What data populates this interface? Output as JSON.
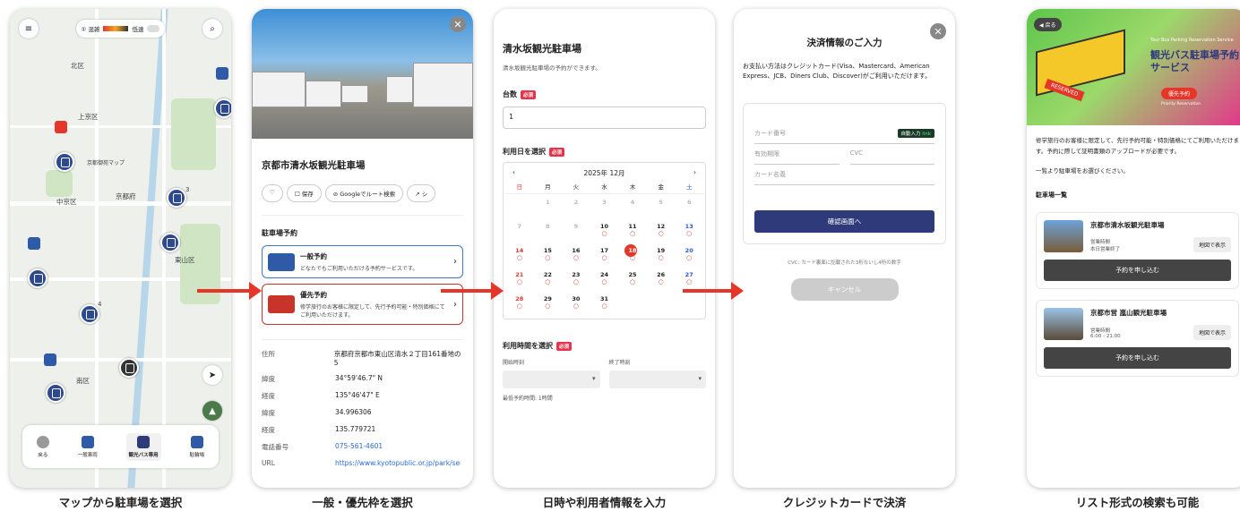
{
  "captions": [
    "マップから駐車場を選択",
    "一般・優先枠を選択",
    "日時や利用者情報を入力",
    "クレジットカードで決済",
    "リスト形式の検索も可能"
  ],
  "map": {
    "congestion_left": "① 混雑",
    "congestion_right": "低速",
    "labels": [
      "北区",
      "上京区",
      "京都府",
      "中京区",
      "京都御苑マップ",
      "東山区",
      "南区",
      "空港",
      "混雑",
      "当条",
      "京都市"
    ],
    "pin_counts": [
      "3",
      "4"
    ],
    "nav": [
      {
        "label": "戻る"
      },
      {
        "label": "一般車両"
      },
      {
        "label": "観光バス専用"
      },
      {
        "label": "駐輪場"
      }
    ]
  },
  "detail": {
    "title": "京都市清水坂観光駐車場",
    "actions": [
      "保存",
      "Googleでルート検索",
      "シ"
    ],
    "section": "駐車場予約",
    "general": {
      "title": "一般予約",
      "desc": "どなたでもご利用いただける予約サービスです。"
    },
    "priority": {
      "title": "優先予約",
      "desc": "修学旅行のお客様に限定して、先行予約可能・特別価格にてご利用いただけます。"
    },
    "info": [
      {
        "k": "住所",
        "v": "京都府京都市東山区清水２丁目161番地の5"
      },
      {
        "k": "緯度",
        "v": "34°59'46.7\" N"
      },
      {
        "k": "経度",
        "v": "135°46'47\" E"
      },
      {
        "k": "緯度",
        "v": "34.996306"
      },
      {
        "k": "経度",
        "v": "135.779721"
      },
      {
        "k": "電話番号",
        "v": "075-561-4601"
      },
      {
        "k": "URL",
        "v": "https://www.kyotopublic.or.jp/park/sei"
      }
    ]
  },
  "booking": {
    "title": "清水坂観光駐車場",
    "subtitle": "清水坂観光駐車場の予約ができます。",
    "count_label": "台数",
    "required": "必須",
    "count_value": "1",
    "date_label": "利用日を選択",
    "month": "2025年 12月",
    "weekdays": [
      "日",
      "月",
      "火",
      "水",
      "木",
      "金",
      "土"
    ],
    "rows": [
      [
        "",
        "1",
        "2",
        "3",
        "4",
        "5",
        "6"
      ],
      [
        "7",
        "8",
        "9",
        "10",
        "11",
        "12",
        "13"
      ],
      [
        "14",
        "15",
        "16",
        "17",
        "18",
        "19",
        "20"
      ],
      [
        "21",
        "22",
        "23",
        "24",
        "25",
        "26",
        "27"
      ],
      [
        "28",
        "29",
        "30",
        "31",
        "",
        "",
        ""
      ]
    ],
    "time_label": "利用時間を選択",
    "start_label": "開始時刻",
    "end_label": "終了時刻",
    "min_note": "最低予約時間: 1時間"
  },
  "payment": {
    "title": "決済情報のご入力",
    "desc": "お支払い方法はクレジットカード(Visa、Mastercard、American Express、JCB、Diners Club、Discover)がご利用いただけます。",
    "card_number": "カード番号",
    "autofill": "自動入力",
    "autofill_brand": "link",
    "expiry": "有効期限",
    "cvc": "CVC",
    "card_name": "カード名義",
    "confirm": "確認画面へ",
    "cvc_note": "CVC: カード裏面に記載された3桁ないし4桁の数字",
    "cancel": "キャンセル"
  },
  "list": {
    "back": "戻る",
    "hero_en": "Tour Bus Parking Reservation Service",
    "hero_title": "観光バス駐車場予約サービス",
    "hero_badge": "優先予約",
    "hero_badge_en": "Priority Reservation",
    "reserved": "RESERVED",
    "intro": "修学旅行のお客様に限定して、先行予約可能・特別価格にてご利用いただけます。予約に際して証明書類のアップロードが必要です。",
    "choose": "一覧より駐車場をお選びください。",
    "list_title": "駐車場一覧",
    "lots": [
      {
        "name": "京都市清水坂観光駐車場",
        "hours_label": "営業時間",
        "hours": "本日営業終了",
        "map": "地図で表示",
        "reserve": "予約を申し込む"
      },
      {
        "name": "京都市営 嵐山観光駐車場",
        "hours_label": "営業時間",
        "hours": "6:00 - 21:00",
        "map": "地図で表示",
        "reserve": "予約を申し込む"
      }
    ]
  },
  "colors": {
    "accent": "#2e3a7a",
    "red": "#e63629"
  }
}
